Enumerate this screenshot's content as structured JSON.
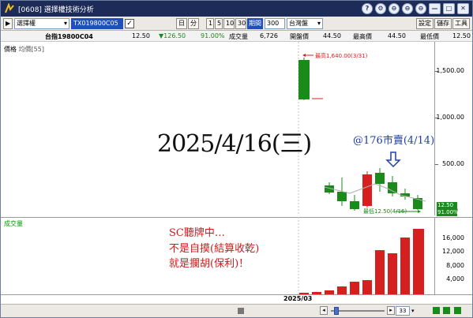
{
  "window": {
    "title": "[0608] 選擇權技術分析",
    "buttons": [
      "?",
      "⚙",
      "⊖",
      "⊖",
      "⊖",
      "—",
      "□",
      "✕"
    ]
  },
  "toolbar": {
    "menu_label": "選擇權",
    "symbol": "TX019800C05",
    "intervals": [
      "日",
      "分",
      "1",
      "5",
      "10",
      "30"
    ],
    "period_label": "期間",
    "period_value": "300",
    "exchange": "台灣盤",
    "right_buttons": [
      "設定",
      "儲存",
      "工具"
    ]
  },
  "quote": {
    "name": "台指19800C04",
    "price": "12.50",
    "change": "▼126.50",
    "pct": "91.00%",
    "volume_label": "成交量",
    "volume": "6,726",
    "open_label": "開盤價",
    "open": "44.50",
    "high_label": "最高價",
    "high": "44.50",
    "low_label": "最低價",
    "low": "12.50"
  },
  "price_panel": {
    "legend_price": "價格",
    "legend_avg": "均價[55]",
    "axis_labels": [
      "1,500.00",
      "1,000.00",
      "500.00",
      "0"
    ],
    "high_note": "最高1,640.00(3/31)",
    "low_note": "最低12.50(4/16)",
    "current_price": "12.50",
    "current_pct": "91.00%"
  },
  "volume_panel": {
    "legend": "成交量",
    "axis_labels": [
      "16,000",
      "12,000",
      "8,000",
      "4,000"
    ]
  },
  "date_axis": {
    "label": "2025/03"
  },
  "bottom": {
    "zoom_value": "33"
  },
  "annotations": {
    "big_date": "2025/4/16(三)",
    "sell_note": "@176市賣(4/14)",
    "msg_line1": "SC聽牌中…",
    "msg_line2": "不是自摸(結算收乾)",
    "msg_line3": "就是攔胡(保利)！"
  },
  "colors": {
    "up": "#d62020",
    "down": "#1a8a1a",
    "title_bar": "#1c2b57",
    "note_blue": "#1f3fa8"
  }
}
